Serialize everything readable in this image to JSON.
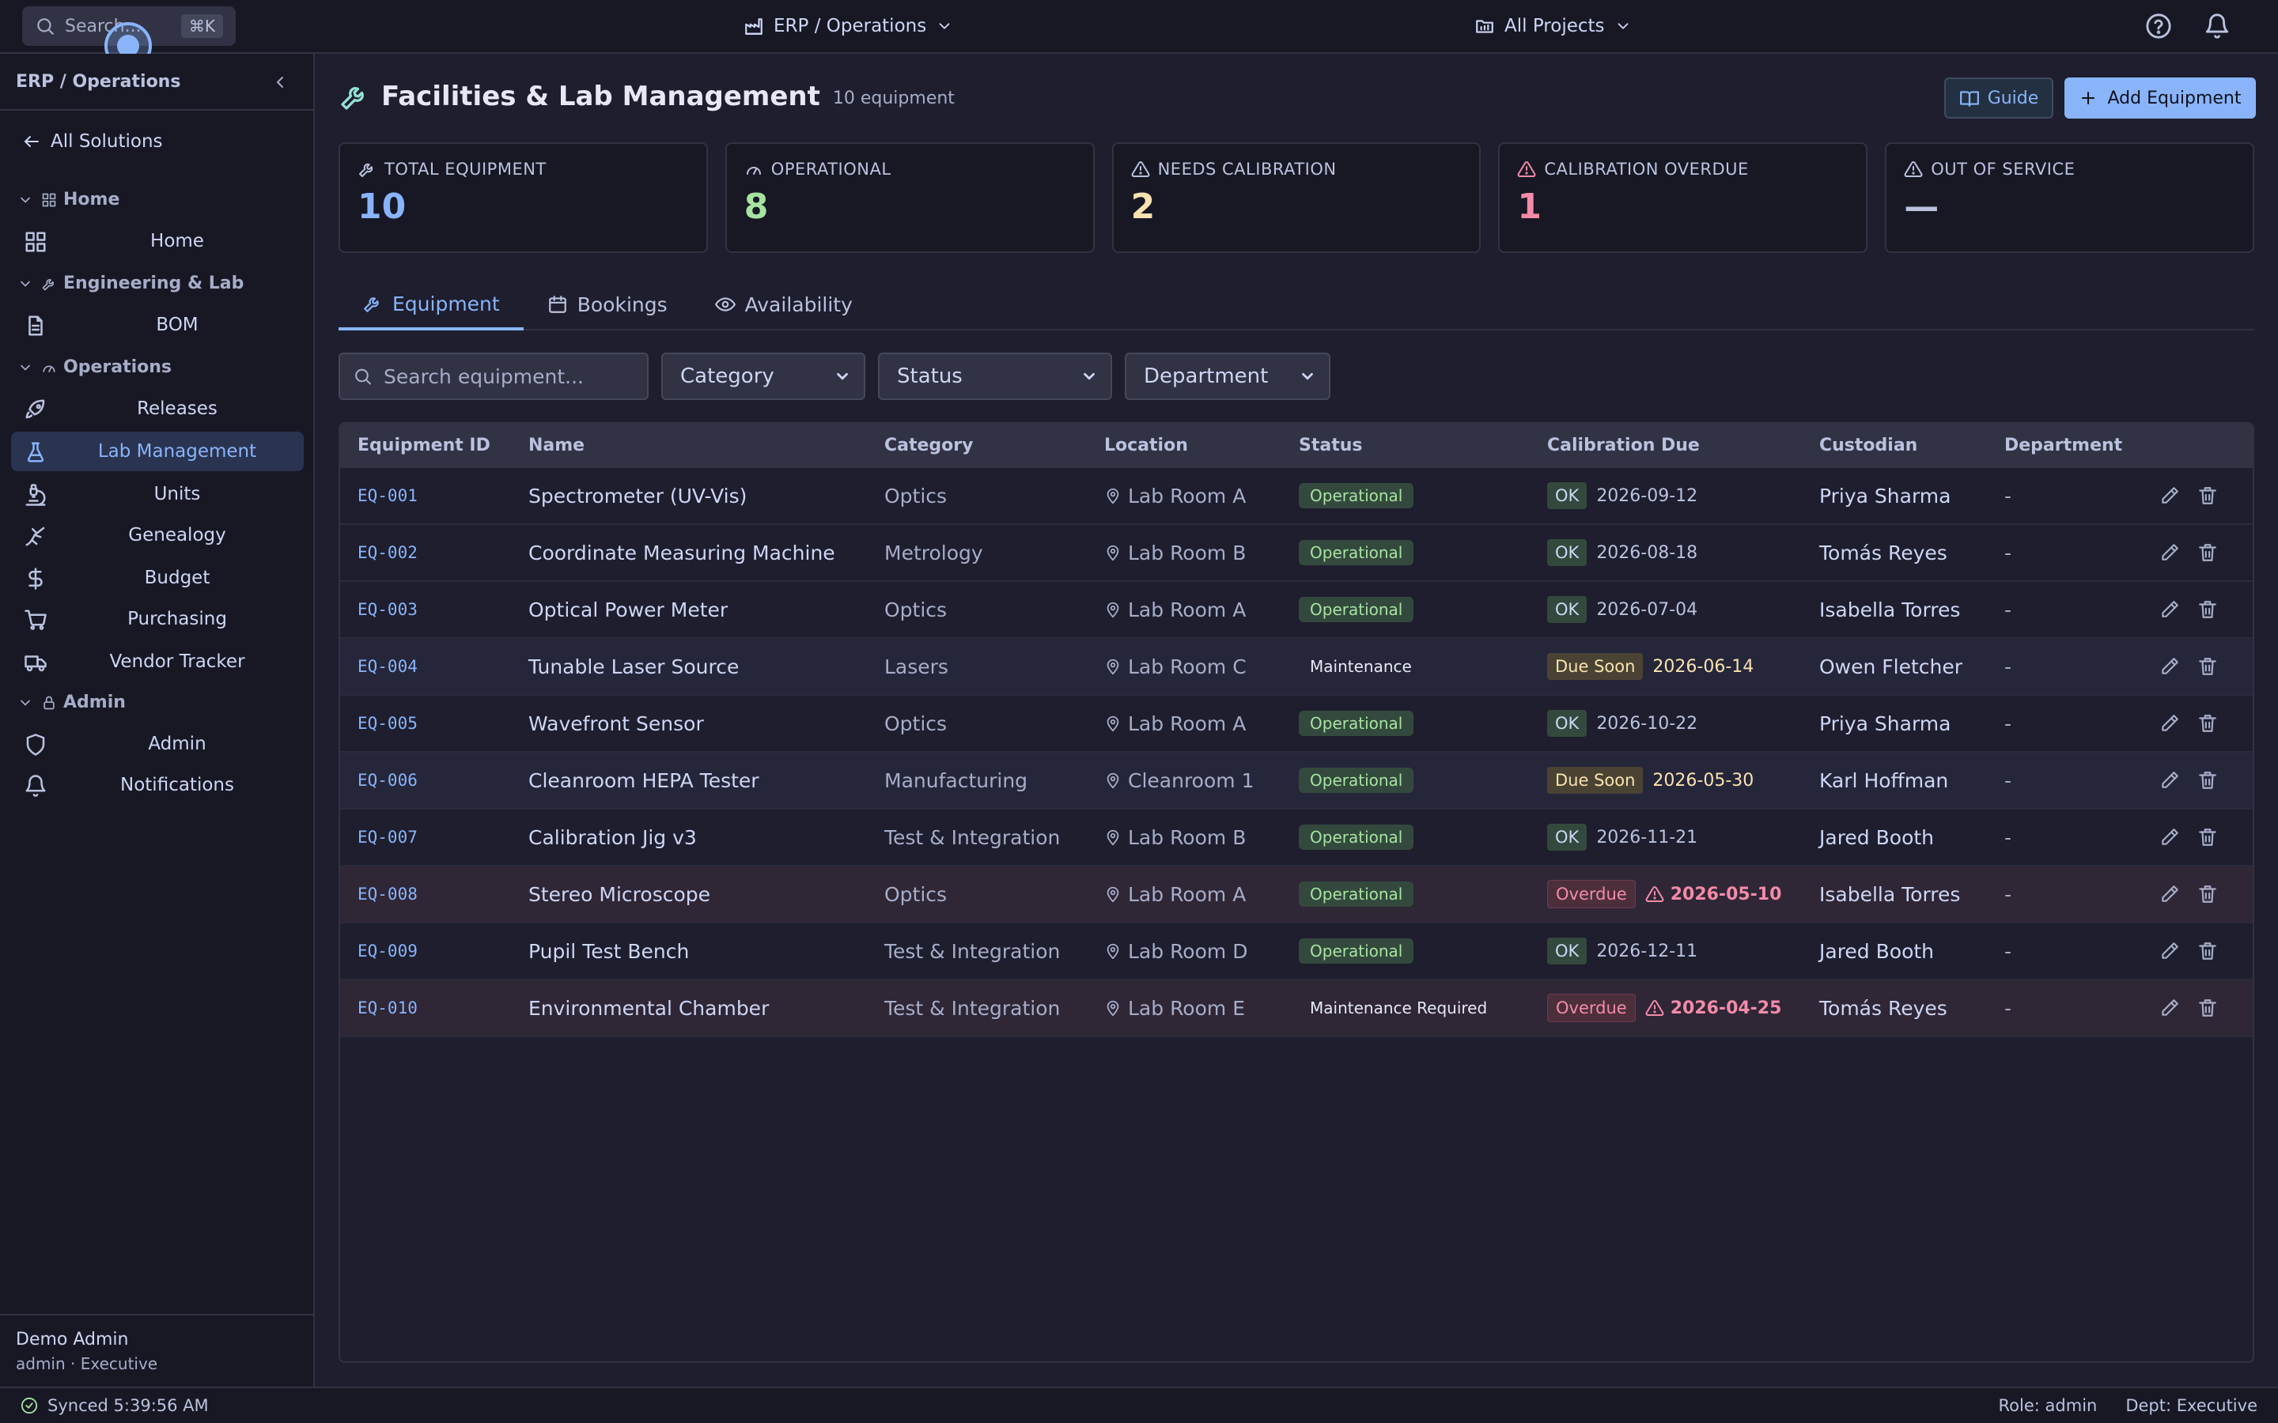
{
  "topbar": {
    "search_label": "Search...",
    "search_shortcut": "⌘K",
    "app_switcher": "ERP / Operations",
    "project_switcher": "All Projects",
    "icons": [
      "help-icon",
      "bell-icon"
    ]
  },
  "sidebar": {
    "title": "ERP / Operations",
    "back_label": "All Solutions",
    "sections": [
      {
        "label": "Home",
        "items": [
          {
            "label": "Home",
            "icon": "grid-icon"
          }
        ]
      },
      {
        "label": "Engineering & Lab",
        "items": [
          {
            "label": "BOM",
            "icon": "file-icon"
          }
        ]
      },
      {
        "label": "Operations",
        "items": [
          {
            "label": "Releases",
            "icon": "rocket-icon"
          },
          {
            "label": "Lab Management",
            "icon": "flask-icon",
            "active": true
          },
          {
            "label": "Units",
            "icon": "microscope-icon"
          },
          {
            "label": "Genealogy",
            "icon": "branch-icon"
          },
          {
            "label": "Budget",
            "icon": "dollar-icon"
          },
          {
            "label": "Purchasing",
            "icon": "cart-icon"
          },
          {
            "label": "Vendor Tracker",
            "icon": "truck-icon"
          }
        ]
      },
      {
        "label": "Admin",
        "items": [
          {
            "label": "Admin",
            "icon": "shield-icon"
          },
          {
            "label": "Notifications",
            "icon": "bell-icon"
          }
        ]
      }
    ],
    "user_name": "Demo Admin",
    "user_role": "admin · Executive"
  },
  "page": {
    "title": "Facilities & Lab Management",
    "count": "10 equipment",
    "guide_label": "Guide",
    "add_label": "Add Equipment"
  },
  "stats": [
    {
      "label": "TOTAL EQUIPMENT",
      "value": "10",
      "color": "#89b4fa",
      "icon": "wrench-icon"
    },
    {
      "label": "OPERATIONAL",
      "value": "8",
      "color": "#a6e3a1",
      "icon": "gauge-icon"
    },
    {
      "label": "NEEDS CALIBRATION",
      "value": "2",
      "color": "#f9e2af",
      "icon": "warning-icon"
    },
    {
      "label": "CALIBRATION OVERDUE",
      "value": "1",
      "color": "#f38ba8",
      "icon": "warning-icon"
    },
    {
      "label": "OUT OF SERVICE",
      "value": "—",
      "color": "#bac2de",
      "icon": "warning-icon"
    }
  ],
  "tabs": [
    {
      "label": "Equipment",
      "icon": "wrench-icon",
      "active": true
    },
    {
      "label": "Bookings",
      "icon": "calendar-icon"
    },
    {
      "label": "Availability",
      "icon": "eye-icon"
    }
  ],
  "filters": {
    "search_placeholder": "Search equipment...",
    "category": "Category",
    "status": "Status",
    "department": "Department"
  },
  "table": {
    "columns": [
      "Equipment ID",
      "Name",
      "Category",
      "Location",
      "Status",
      "Calibration Due",
      "Custodian",
      "Department"
    ],
    "rows": [
      {
        "id": "EQ-001",
        "name": "Spectrometer (UV-Vis)",
        "category": "Optics",
        "location": "Lab Room A",
        "status": "Operational",
        "cal_state": "OK",
        "cal_date": "2026-09-12",
        "custodian": "Priya Sharma",
        "department": "-"
      },
      {
        "id": "EQ-002",
        "name": "Coordinate Measuring Machine",
        "category": "Metrology",
        "location": "Lab Room B",
        "status": "Operational",
        "cal_state": "OK",
        "cal_date": "2026-08-18",
        "custodian": "Tomás Reyes",
        "department": "-"
      },
      {
        "id": "EQ-003",
        "name": "Optical Power Meter",
        "category": "Optics",
        "location": "Lab Room A",
        "status": "Operational",
        "cal_state": "OK",
        "cal_date": "2026-07-04",
        "custodian": "Isabella Torres",
        "department": "-"
      },
      {
        "id": "EQ-004",
        "name": "Tunable Laser Source",
        "category": "Lasers",
        "location": "Lab Room C",
        "status": "Maintenance",
        "cal_state": "Due Soon",
        "cal_date": "2026-06-14",
        "custodian": "Owen Fletcher",
        "department": "-"
      },
      {
        "id": "EQ-005",
        "name": "Wavefront Sensor",
        "category": "Optics",
        "location": "Lab Room A",
        "status": "Operational",
        "cal_state": "OK",
        "cal_date": "2026-10-22",
        "custodian": "Priya Sharma",
        "department": "-"
      },
      {
        "id": "EQ-006",
        "name": "Cleanroom HEPA Tester",
        "category": "Manufacturing",
        "location": "Cleanroom 1",
        "status": "Operational",
        "cal_state": "Due Soon",
        "cal_date": "2026-05-30",
        "custodian": "Karl Hoffman",
        "department": "-"
      },
      {
        "id": "EQ-007",
        "name": "Calibration Jig v3",
        "category": "Test & Integration",
        "location": "Lab Room B",
        "status": "Operational",
        "cal_state": "OK",
        "cal_date": "2026-11-21",
        "custodian": "Jared Booth",
        "department": "-"
      },
      {
        "id": "EQ-008",
        "name": "Stereo Microscope",
        "category": "Optics",
        "location": "Lab Room A",
        "status": "Operational",
        "cal_state": "Overdue",
        "cal_date": "2026-05-10",
        "custodian": "Isabella Torres",
        "department": "-"
      },
      {
        "id": "EQ-009",
        "name": "Pupil Test Bench",
        "category": "Test & Integration",
        "location": "Lab Room D",
        "status": "Operational",
        "cal_state": "OK",
        "cal_date": "2026-12-11",
        "custodian": "Jared Booth",
        "department": "-"
      },
      {
        "id": "EQ-010",
        "name": "Environmental Chamber",
        "category": "Test & Integration",
        "location": "Lab Room E",
        "status": "Maintenance Required",
        "cal_state": "Overdue",
        "cal_date": "2026-04-25",
        "custodian": "Tomás Reyes",
        "department": "-"
      }
    ]
  },
  "statusbar": {
    "sync": "Synced 5:39:56 AM",
    "role": "Role: admin",
    "dept": "Dept: Executive"
  }
}
